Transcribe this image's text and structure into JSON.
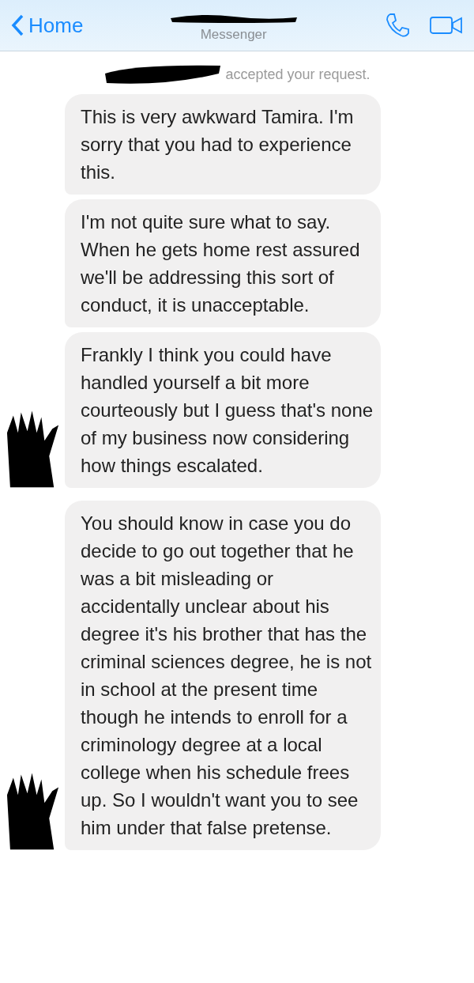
{
  "header": {
    "back_label": "Home",
    "subtitle": "Messenger"
  },
  "notice": "accepted your request.",
  "messages": [
    {
      "text": "This is very awkward Tamira. I'm sorry that you had to experience this.",
      "avatar": false
    },
    {
      "text": "I'm not quite sure what to say. When he gets home rest assured we'll be addressing this sort of conduct, it is unacceptable.",
      "avatar": false
    },
    {
      "text": "Frankly I think you could have handled yourself a bit more courteously but I guess that's none of my business now considering how things escalated.",
      "avatar": true
    },
    {
      "text": "You should know in case you do decide to go out together that he was a bit misleading or accidentally unclear about his degree it's his brother that has the criminal sciences degree, he is not in school at the present time though he intends to enroll for a criminology degree at a local college when his schedule frees up. So I wouldn't want you to see him under that false pretense.",
      "avatar": true
    }
  ]
}
